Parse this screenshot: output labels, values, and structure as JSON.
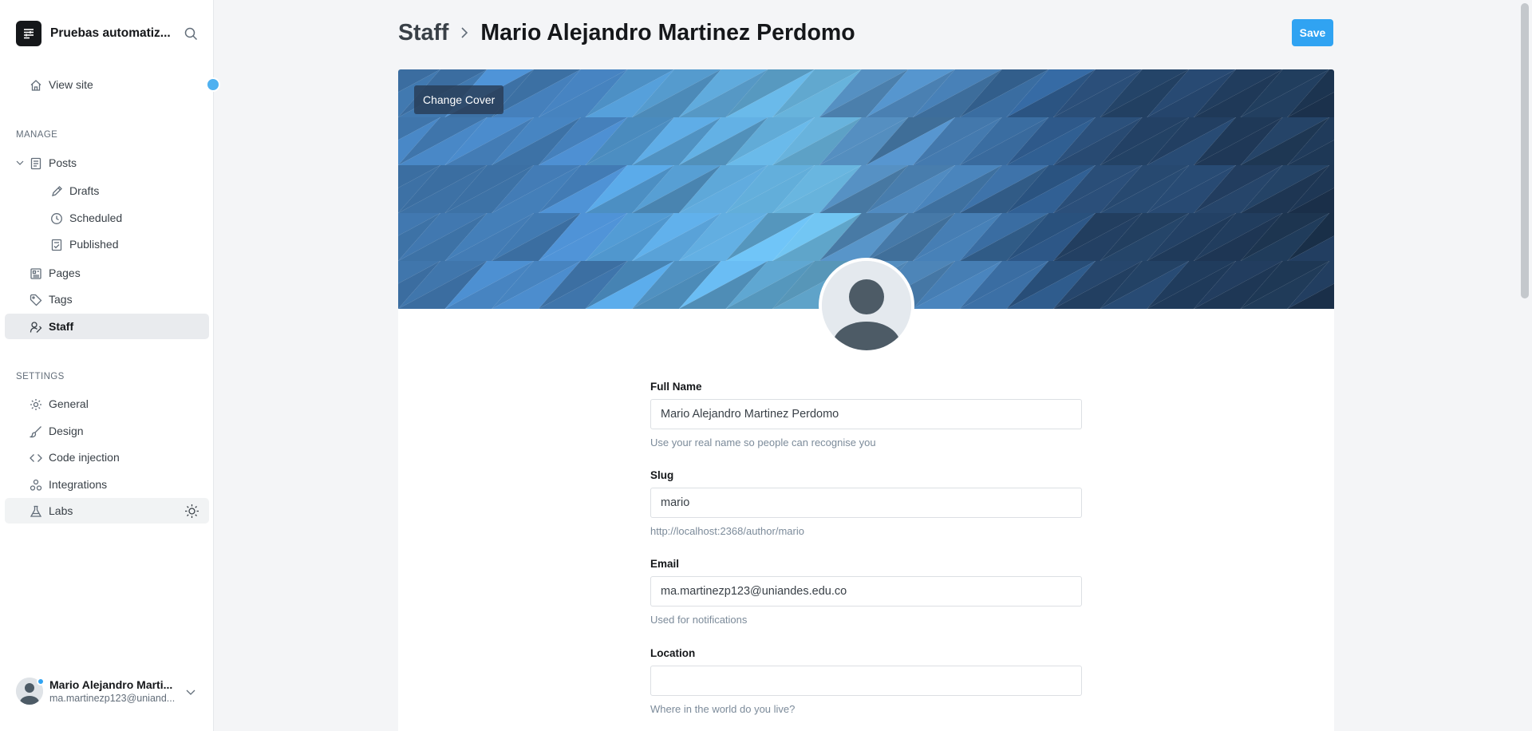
{
  "app": {
    "site_title": "Pruebas automatiz...",
    "search_icon": "search-icon"
  },
  "sidebar": {
    "view_site": "View site",
    "manage_label": "MANAGE",
    "settings_label": "SETTINGS",
    "posts": "Posts",
    "drafts": "Drafts",
    "scheduled": "Scheduled",
    "published": "Published",
    "pages": "Pages",
    "tags": "Tags",
    "staff": "Staff",
    "general": "General",
    "design": "Design",
    "code_injection": "Code injection",
    "integrations": "Integrations",
    "labs": "Labs"
  },
  "user": {
    "name": "Mario Alejandro Marti...",
    "email": "ma.martinezp123@uniand..."
  },
  "header": {
    "crumb_parent": "Staff",
    "crumb_current": "Mario Alejandro Martinez Perdomo",
    "save_label": "Save"
  },
  "profile": {
    "change_cover": "Change Cover",
    "full_name_label": "Full Name",
    "full_name_value": "Mario Alejandro Martinez Perdomo",
    "full_name_hint": "Use your real name so people can recognise you",
    "slug_label": "Slug",
    "slug_value": "mario",
    "slug_hint": "http://localhost:2368/author/mario",
    "email_label": "Email",
    "email_value": "ma.martinezp123@uniandes.edu.co",
    "email_hint": "Used for notifications",
    "location_label": "Location",
    "location_value": "",
    "location_hint": "Where in the world do you live?"
  },
  "colors": {
    "accent": "#30a3f2",
    "active_nav_bg": "#e9ebee",
    "text_primary": "#15171a"
  }
}
